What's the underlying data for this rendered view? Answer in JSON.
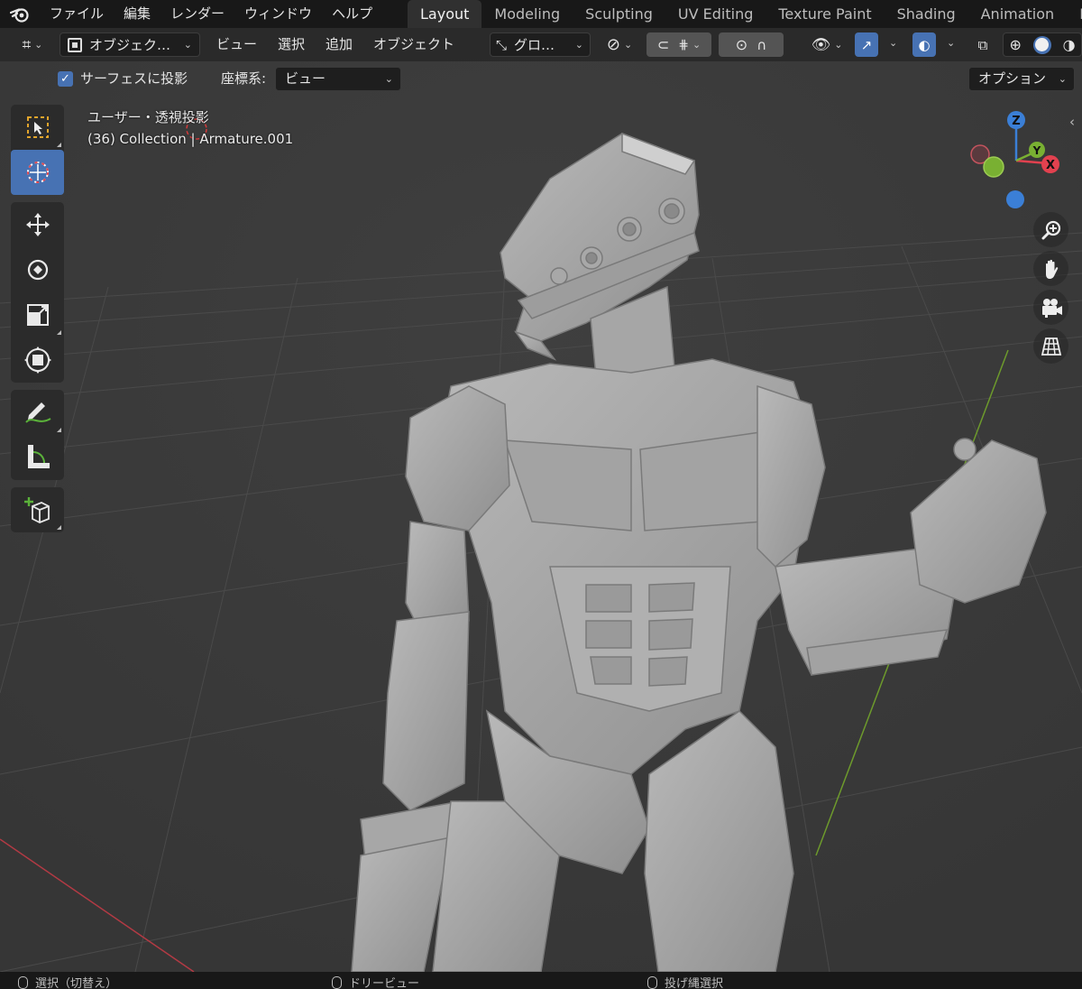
{
  "menu": {
    "items": [
      "ファイル",
      "編集",
      "レンダー",
      "ウィンドウ",
      "ヘルプ"
    ]
  },
  "workspaces": {
    "tabs": [
      "Layout",
      "Modeling",
      "Sculpting",
      "UV Editing",
      "Texture Paint",
      "Shading",
      "Animation",
      "Rend"
    ],
    "active": "Layout"
  },
  "header": {
    "mode_label": "オブジェク…",
    "view_menu": "ビュー",
    "select_menu": "選択",
    "add_menu": "追加",
    "object_menu": "オブジェクト",
    "transform_orientation": "グロ…"
  },
  "options": {
    "project_surface_checked": true,
    "project_surface_label": "サーフェスに投影",
    "coord_system_label": "座標系:",
    "coord_system_value": "ビュー",
    "options_button": "オプション"
  },
  "viewport": {
    "view_name": "ユーザー・透視投影",
    "collection_info": "(36) Collection | Armature.001",
    "gizmo": {
      "z": "Z",
      "y": "Y",
      "x": "X"
    }
  },
  "colors": {
    "accent": "#4772b3",
    "axis_x": "#e2414f",
    "axis_y": "#79b032",
    "axis_z": "#3b7fd6"
  },
  "tools": [
    "select-box",
    "cursor",
    "move",
    "rotate",
    "scale",
    "transform",
    "annotate",
    "measure",
    "add-cube"
  ],
  "statusbar": {
    "left": "選択（切替え）",
    "middle": "ドリービュー",
    "right": "投げ縄選択"
  }
}
